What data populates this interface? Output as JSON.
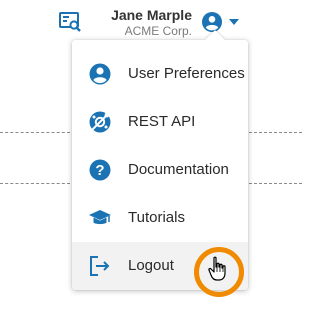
{
  "header": {
    "user_name": "Jane Marple",
    "company": "ACME Corp.",
    "icons": {
      "log": "search-log-icon",
      "avatar": "user-circle-icon",
      "caret": "caret-down-icon"
    }
  },
  "menu": {
    "items": [
      {
        "label": "User Preferences",
        "icon": "user-circle-icon"
      },
      {
        "label": "REST API",
        "icon": "api-icon"
      },
      {
        "label": "Documentation",
        "icon": "question-circle-icon"
      },
      {
        "label": "Tutorials",
        "icon": "graduation-cap-icon"
      },
      {
        "label": "Logout",
        "icon": "logout-icon",
        "hovered": true
      }
    ]
  },
  "cursor": {
    "icon": "hand-pointer-icon",
    "highlight_color": "#f08a00"
  },
  "colors": {
    "accent": "#1b73b3",
    "name_text": "#333333",
    "company_text": "#7a7a7a",
    "hover_bg": "#f2f2f2"
  }
}
